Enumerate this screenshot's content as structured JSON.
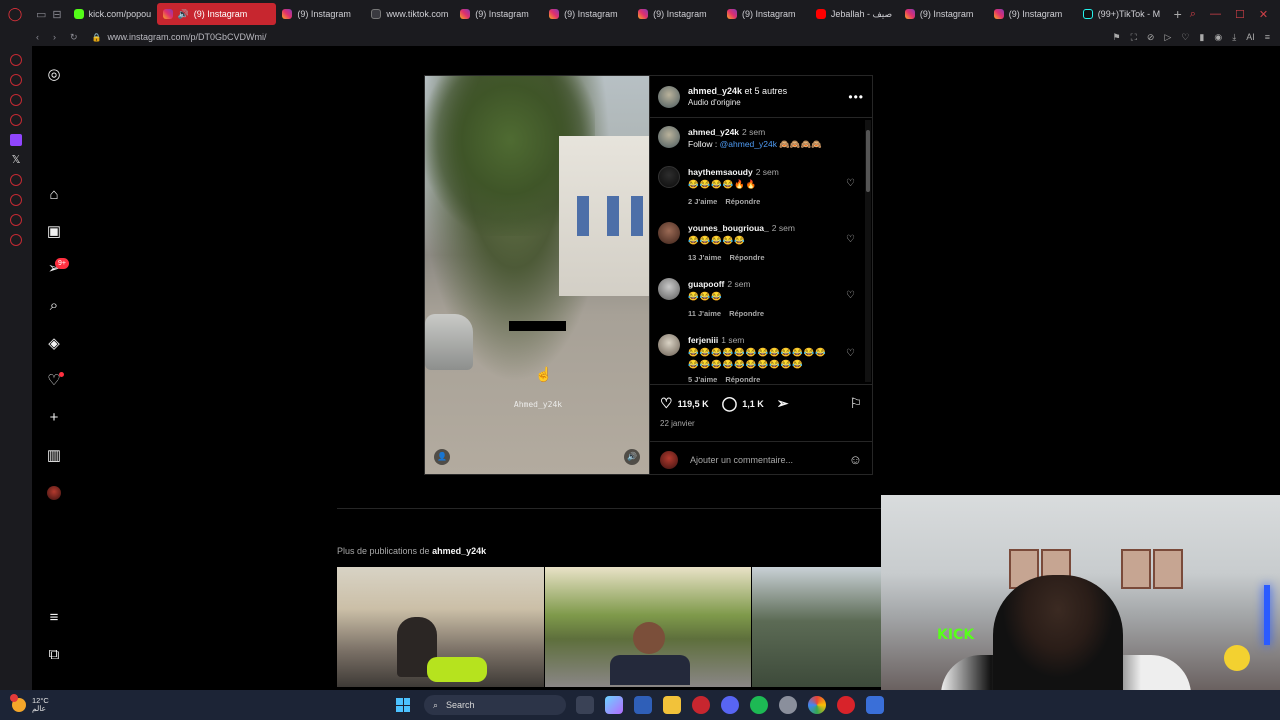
{
  "browser": {
    "tabs": [
      {
        "label": "kick.com/popou",
        "icon": "kick"
      },
      {
        "label": "(9) Instagram",
        "icon": "ig",
        "active": true
      },
      {
        "label": "(9) Instagram",
        "icon": "ig"
      },
      {
        "label": "www.tiktok.com",
        "icon": "web"
      },
      {
        "label": "(9) Instagram",
        "icon": "ig"
      },
      {
        "label": "(9) Instagram",
        "icon": "ig"
      },
      {
        "label": "(9) Instagram",
        "icon": "ig"
      },
      {
        "label": "(9) Instagram",
        "icon": "ig"
      },
      {
        "label": "Jeballah - صيف",
        "icon": "yt"
      },
      {
        "label": "(9) Instagram",
        "icon": "ig"
      },
      {
        "label": "(9) Instagram",
        "icon": "ig"
      },
      {
        "label": "(99+)TikTok - M",
        "icon": "tt"
      }
    ],
    "url": "www.instagram.com/p/DT0GbCVDWmi/",
    "accent": "#c7262f"
  },
  "nav": {
    "notification_badge": "9+",
    "icons": [
      "instagram-logo-icon",
      "home-icon",
      "reels-icon",
      "messages-icon",
      "search-icon",
      "explore-icon",
      "notifications-icon",
      "create-icon",
      "dashboard-icon",
      "profile-icon",
      "menu-icon",
      "meta-apps-icon"
    ]
  },
  "post": {
    "header_user": "ahmed_y24k",
    "header_others": " et 5 autres",
    "audio": "Audio d'origine",
    "media_watermark": "Ahmed_y24k",
    "caption": {
      "user": "ahmed_y24k",
      "time": "2 sem",
      "text_prefix": "Follow : ",
      "mention": "@ahmed_y24k",
      "emojis": "🙈🙈🙈🙈"
    },
    "comments": [
      {
        "user": "haythemsaoudy",
        "time": "2 sem",
        "text": "😂😂😂😂🔥🔥",
        "likes": "2 J'aime",
        "reply": "Répondre"
      },
      {
        "user": "younes_bougrioua_",
        "time": "2 sem",
        "text": "😂😂😂😂😂",
        "likes": "13 J'aime",
        "reply": "Répondre"
      },
      {
        "user": "guapooff",
        "time": "2 sem",
        "text": "😂😂😂",
        "likes": "11 J'aime",
        "reply": "Répondre"
      },
      {
        "user": "ferjeniii",
        "time": "1 sem",
        "text": "😂😂😂😂😂😂😂😂😂😂😂😂😂😂😂😂😂😂😂😂😂😂",
        "likes": "5 J'aime",
        "reply": "Répondre"
      }
    ],
    "likes_count": "119,5 K",
    "comments_count": "1,1 K",
    "date": "22 janvier",
    "comment_placeholder": "Ajouter un commentaire..."
  },
  "more": {
    "prefix": "Plus de publications de ",
    "user": "ahmed_y24k"
  },
  "taskbar": {
    "temp": "12°C",
    "location": "عالم",
    "search": "Search"
  }
}
